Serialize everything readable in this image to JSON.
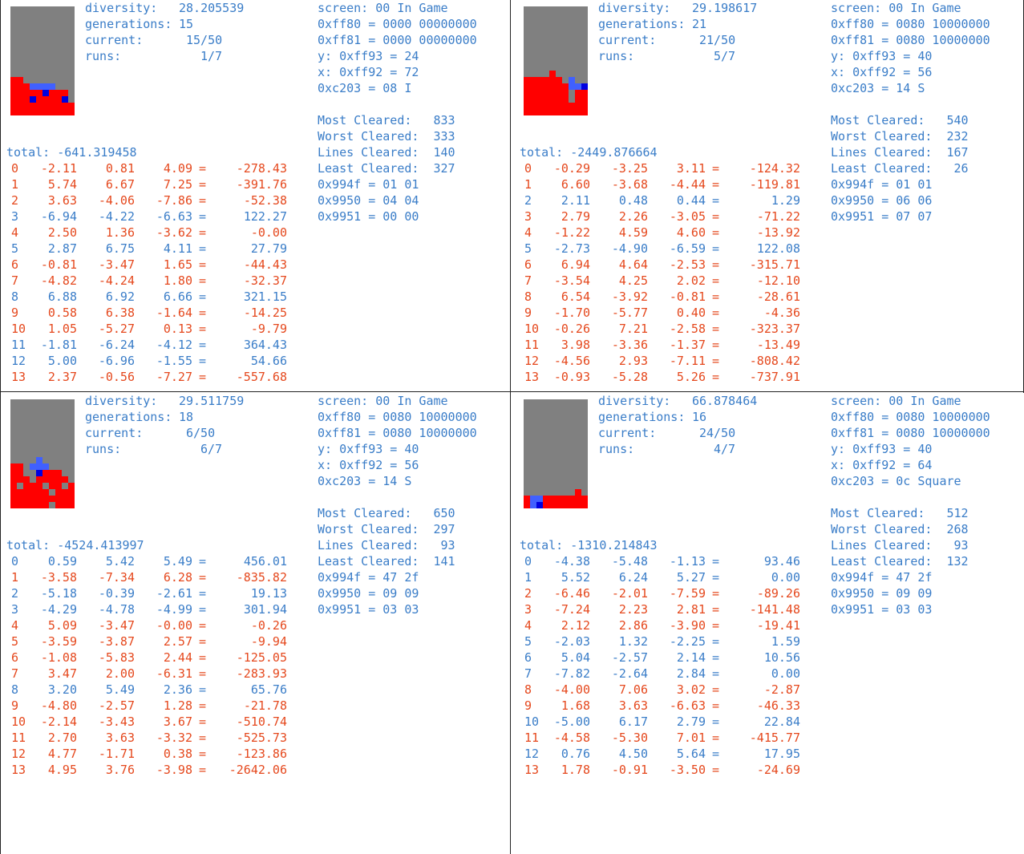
{
  "colors": {
    "blue": "#3a7dc8",
    "red": "#e5481d",
    "board_bg": "#808080",
    "piece_red": "#ff0000",
    "piece_blue": "#4060ff",
    "piece_dark": "#0000e0"
  },
  "panels": [
    {
      "diversity_label": "diversity:",
      "diversity": "28.205539",
      "generations_label": "generations:",
      "generations": "15",
      "current_label": "current:",
      "current": "15/50",
      "runs_label": "runs:",
      "runs": "1/7",
      "screen": "screen: 00 In Game",
      "ff80": "0xff80 = 0000 00000000",
      "ff81": "0xff81 = 0000 00000000",
      "y": "y: 0xff93 = 24",
      "x": "x: 0xff92 = 72",
      "c203": "0xc203 = 08 I",
      "most_cleared": "Most Cleared:   833",
      "worst_cleared": "Worst Cleared:  333",
      "lines_cleared": "Lines Cleared:  140",
      "least_cleared": "Least Cleared:  327",
      "m994f": "0x994f = 01 01",
      "m9950": "0x9950 = 04 04",
      "m9951": "0x9951 = 00 00",
      "total": "total: -641.319458",
      "rows": [
        [
          "0",
          "-2.11",
          "0.81",
          "4.09",
          "-278.43"
        ],
        [
          "1",
          "5.74",
          "6.67",
          "7.25",
          "-391.76"
        ],
        [
          "2",
          "3.63",
          "-4.06",
          "-7.86",
          "-52.38"
        ],
        [
          "3",
          "-6.94",
          "-4.22",
          "-6.63",
          "122.27"
        ],
        [
          "4",
          "2.50",
          "1.36",
          "-3.62",
          "-0.00"
        ],
        [
          "5",
          "2.87",
          "6.75",
          "4.11",
          "27.79"
        ],
        [
          "6",
          "-0.81",
          "-3.47",
          "1.65",
          "-44.43"
        ],
        [
          "7",
          "-4.82",
          "-4.24",
          "1.80",
          "-32.37"
        ],
        [
          "8",
          "6.88",
          "6.92",
          "6.66",
          "321.15"
        ],
        [
          "9",
          "0.58",
          "6.38",
          "-1.64",
          "-14.25"
        ],
        [
          "10",
          "1.05",
          "-5.27",
          "0.13",
          "-9.79"
        ],
        [
          "11",
          "-1.81",
          "-6.24",
          "-4.12",
          "364.43"
        ],
        [
          "12",
          "5.00",
          "-6.96",
          "-1.55",
          "54.66"
        ],
        [
          "13",
          "2.37",
          "-0.56",
          "-7.27",
          "-557.68"
        ]
      ]
    },
    {
      "diversity_label": "diversity:",
      "diversity": "29.198617",
      "generations_label": "generations:",
      "generations": "21",
      "current_label": "current:",
      "current": "21/50",
      "runs_label": "runs:",
      "runs": "5/7",
      "screen": "screen: 00 In Game",
      "ff80": "0xff80 = 0080 10000000",
      "ff81": "0xff81 = 0080 10000000",
      "y": "y: 0xff93 = 40",
      "x": "x: 0xff92 = 56",
      "c203": "0xc203 = 14 S",
      "most_cleared": "Most Cleared:   540",
      "worst_cleared": "Worst Cleared:  232",
      "lines_cleared": "Lines Cleared:  167",
      "least_cleared": "Least Cleared:   26",
      "m994f": "0x994f = 01 01",
      "m9950": "0x9950 = 06 06",
      "m9951": "0x9951 = 07 07",
      "total": "total: -2449.876664",
      "rows": [
        [
          "0",
          "-0.29",
          "-3.25",
          "3.11",
          "-124.32"
        ],
        [
          "1",
          "6.60",
          "-3.68",
          "-4.44",
          "-119.81"
        ],
        [
          "2",
          "2.11",
          "0.48",
          "0.44",
          "1.29"
        ],
        [
          "3",
          "2.79",
          "2.26",
          "-3.05",
          "-71.22"
        ],
        [
          "4",
          "-1.22",
          "4.59",
          "4.60",
          "-13.92"
        ],
        [
          "5",
          "-2.73",
          "-4.90",
          "-6.59",
          "122.08"
        ],
        [
          "6",
          "6.94",
          "4.64",
          "-2.53",
          "-315.71"
        ],
        [
          "7",
          "-3.54",
          "4.25",
          "2.02",
          "-12.10"
        ],
        [
          "8",
          "6.54",
          "-3.92",
          "-0.81",
          "-28.61"
        ],
        [
          "9",
          "-1.70",
          "-5.77",
          "0.40",
          "-4.36"
        ],
        [
          "10",
          "-0.26",
          "7.21",
          "-2.58",
          "-323.37"
        ],
        [
          "11",
          "3.98",
          "-3.36",
          "-1.37",
          "-13.49"
        ],
        [
          "12",
          "-4.56",
          "2.93",
          "-7.11",
          "-808.42"
        ],
        [
          "13",
          "-0.93",
          "-5.28",
          "5.26",
          "-737.91"
        ]
      ]
    },
    {
      "diversity_label": "diversity:",
      "diversity": "29.511759",
      "generations_label": "generations:",
      "generations": "18",
      "current_label": "current:",
      "current": "6/50",
      "runs_label": "runs:",
      "runs": "6/7",
      "screen": "screen: 00 In Game",
      "ff80": "0xff80 = 0080 10000000",
      "ff81": "0xff81 = 0080 10000000",
      "y": "y: 0xff93 = 40",
      "x": "x: 0xff92 = 56",
      "c203": "0xc203 = 14 S",
      "most_cleared": "Most Cleared:   650",
      "worst_cleared": "Worst Cleared:  297",
      "lines_cleared": "Lines Cleared:   93",
      "least_cleared": "Least Cleared:  141",
      "m994f": "0x994f = 47 2f",
      "m9950": "0x9950 = 09 09",
      "m9951": "0x9951 = 03 03",
      "total": "total: -4524.413997",
      "rows": [
        [
          "0",
          "0.59",
          "5.42",
          "5.49",
          "456.01"
        ],
        [
          "1",
          "-3.58",
          "-7.34",
          "6.28",
          "-835.82"
        ],
        [
          "2",
          "-5.18",
          "-0.39",
          "-2.61",
          "19.13"
        ],
        [
          "3",
          "-4.29",
          "-4.78",
          "-4.99",
          "301.94"
        ],
        [
          "4",
          "5.09",
          "-3.47",
          "-0.00",
          "-0.26"
        ],
        [
          "5",
          "-3.59",
          "-3.87",
          "2.57",
          "-9.94"
        ],
        [
          "6",
          "-1.08",
          "-5.83",
          "2.44",
          "-125.05"
        ],
        [
          "7",
          "3.47",
          "2.00",
          "-6.31",
          "-283.93"
        ],
        [
          "8",
          "3.20",
          "5.49",
          "2.36",
          "65.76"
        ],
        [
          "9",
          "-4.80",
          "-2.57",
          "1.28",
          "-21.78"
        ],
        [
          "10",
          "-2.14",
          "-3.43",
          "3.67",
          "-510.74"
        ],
        [
          "11",
          "2.70",
          "3.63",
          "-3.32",
          "-525.73"
        ],
        [
          "12",
          "4.77",
          "-1.71",
          "0.38",
          "-123.86"
        ],
        [
          "13",
          "4.95",
          "3.76",
          "-3.98",
          "-2642.06"
        ]
      ]
    },
    {
      "diversity_label": "diversity:",
      "diversity": "66.878464",
      "generations_label": "generations:",
      "generations": "16",
      "current_label": "current:",
      "current": "24/50",
      "runs_label": "runs:",
      "runs": "4/7",
      "screen": "screen: 00 In Game",
      "ff80": "0xff80 = 0080 10000000",
      "ff81": "0xff81 = 0080 10000000",
      "y": "y: 0xff93 = 40",
      "x": "x: 0xff92 = 64",
      "c203": "0xc203 = 0c Square",
      "most_cleared": "Most Cleared:   512",
      "worst_cleared": "Worst Cleared:  268",
      "lines_cleared": "Lines Cleared:   93",
      "least_cleared": "Least Cleared:  132",
      "m994f": "0x994f = 47 2f",
      "m9950": "0x9950 = 09 09",
      "m9951": "0x9951 = 03 03",
      "total": "total: -1310.214843",
      "rows": [
        [
          "0",
          "-4.38",
          "-5.48",
          "-1.13",
          "93.46"
        ],
        [
          "1",
          "5.52",
          "6.24",
          "5.27",
          "0.00"
        ],
        [
          "2",
          "-6.46",
          "-2.01",
          "-7.59",
          "-89.26"
        ],
        [
          "3",
          "-7.24",
          "2.23",
          "2.81",
          "-141.48"
        ],
        [
          "4",
          "2.12",
          "2.86",
          "-3.90",
          "-19.41"
        ],
        [
          "5",
          "-2.03",
          "1.32",
          "-2.25",
          "1.59"
        ],
        [
          "6",
          "5.04",
          "-2.57",
          "2.14",
          "10.56"
        ],
        [
          "7",
          "-7.82",
          "-2.64",
          "2.84",
          "0.00"
        ],
        [
          "8",
          "-4.00",
          "7.06",
          "3.02",
          "-2.87"
        ],
        [
          "9",
          "1.68",
          "3.63",
          "-6.63",
          "-46.33"
        ],
        [
          "10",
          "-5.00",
          "6.17",
          "2.79",
          "22.84"
        ],
        [
          "11",
          "-4.58",
          "-5.30",
          "7.01",
          "-415.77"
        ],
        [
          "12",
          "0.76",
          "4.50",
          "5.64",
          "17.95"
        ],
        [
          "13",
          "1.78",
          "-0.91",
          "-3.50",
          "-24.69"
        ]
      ]
    }
  ]
}
